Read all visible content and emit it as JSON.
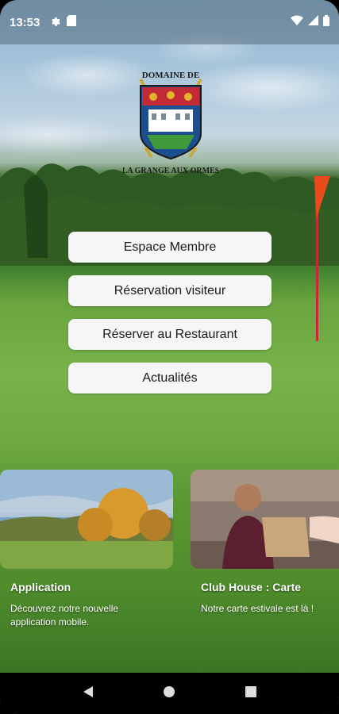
{
  "status_bar": {
    "time": "13:53",
    "left_icons": [
      "gear-icon",
      "sd-card-icon"
    ],
    "right_icons": [
      "wifi-icon",
      "signal-icon",
      "battery-icon"
    ]
  },
  "logo": {
    "top_text": "DOMAINE DE",
    "bottom_text": "LA GRANGE AUX ORMES"
  },
  "menu": {
    "items": [
      {
        "label": "Espace Membre"
      },
      {
        "label": "Réservation visiteur"
      },
      {
        "label": "Réserver au Restaurant"
      },
      {
        "label": "Actualités"
      }
    ]
  },
  "cards": [
    {
      "title": "Application",
      "description": "Découvrez notre nouvelle\napplication mobile."
    },
    {
      "title": "Club House : Carte",
      "description": "Notre carte estivale est là !"
    }
  ],
  "nav_bar": {
    "icons": [
      "back-icon",
      "home-icon",
      "recents-icon"
    ]
  },
  "colors": {
    "button_bg": "#f6f6f6",
    "flag": "#e8491d"
  }
}
